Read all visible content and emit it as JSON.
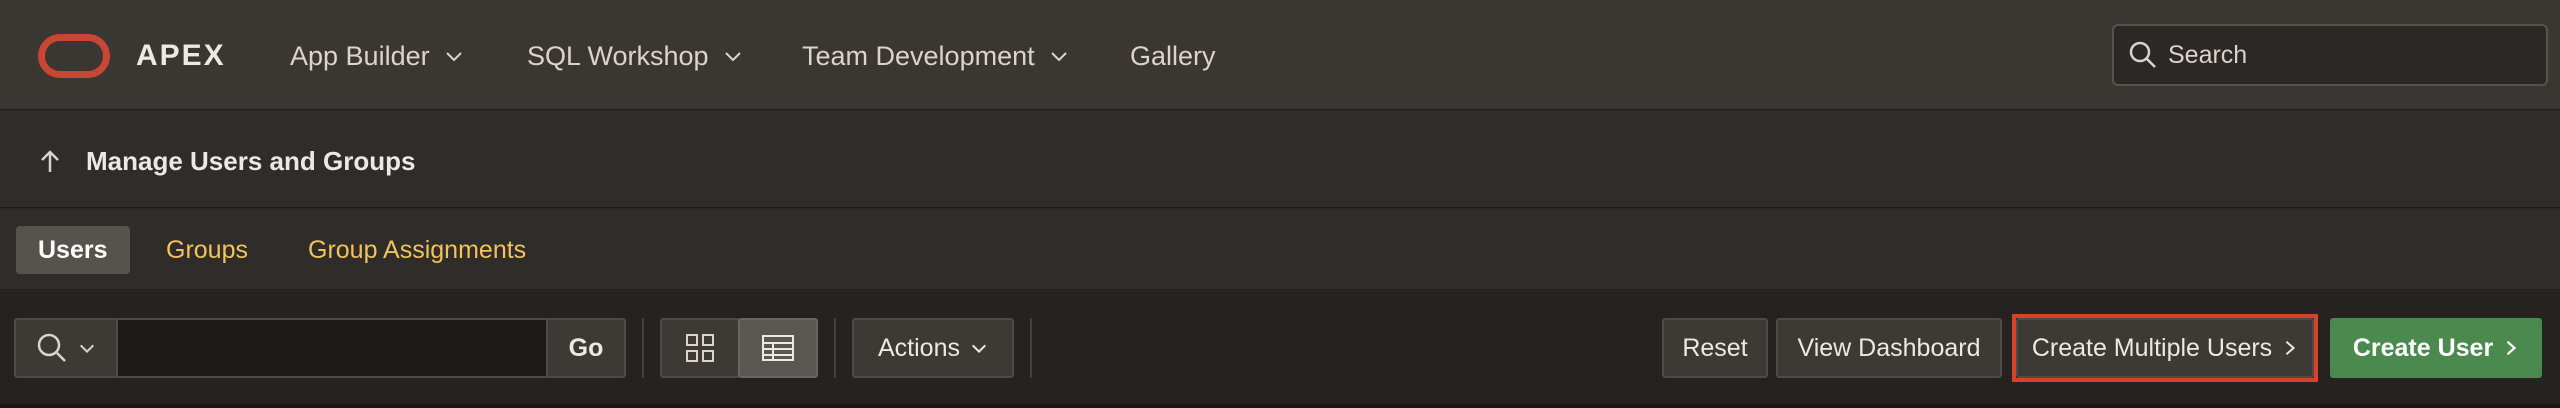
{
  "brand": {
    "name": "APEX",
    "accent": "#c74634"
  },
  "nav": {
    "items": [
      {
        "label": "App Builder",
        "icon": "chevron-down-icon"
      },
      {
        "label": "SQL Workshop",
        "icon": "chevron-down-icon"
      },
      {
        "label": "Team Development",
        "icon": "chevron-down-icon"
      },
      {
        "label": "Gallery"
      }
    ],
    "search": {
      "placeholder": "Search",
      "value": "",
      "icon": "search-icon"
    }
  },
  "breadcrumb": {
    "up_icon": "arrow-up-icon",
    "title": "Manage Users and Groups"
  },
  "tabs": [
    {
      "label": "Users",
      "active": true
    },
    {
      "label": "Groups",
      "active": false
    },
    {
      "label": "Group Assignments",
      "active": false
    }
  ],
  "toolbar": {
    "search_value": "",
    "go_label": "Go",
    "view_icons": [
      "grid-view-icon",
      "report-view-icon"
    ],
    "actions_label": "Actions",
    "reset_label": "Reset",
    "view_dashboard_label": "View Dashboard",
    "create_multiple_label": "Create Multiple Users",
    "create_user_label": "Create User",
    "highlight_color": "#d8412a",
    "primary_color": "#4a8a4f"
  }
}
